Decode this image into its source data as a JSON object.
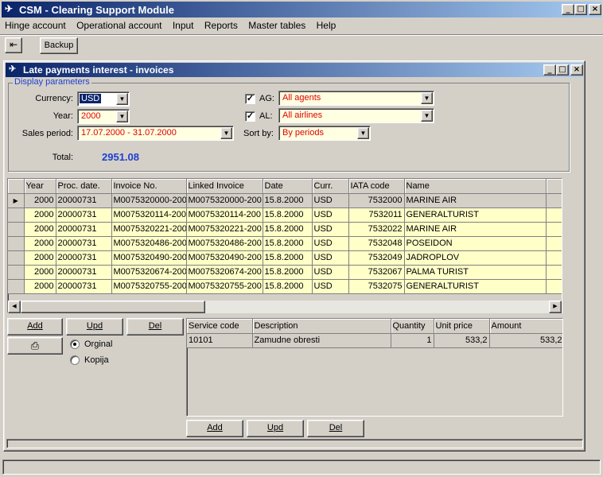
{
  "app": {
    "title": "CSM - Clearing Support Module",
    "menu": [
      "Hinge account",
      "Operational account",
      "Input",
      "Reports",
      "Master tables",
      "Help"
    ],
    "toolbar": {
      "backup_label": "Backup"
    }
  },
  "window": {
    "title": "Late payments interest - invoices",
    "display_parameters_label": "Display parameters",
    "currency": {
      "label": "Currency:",
      "value": "USD"
    },
    "year": {
      "label": "Year:",
      "value": "2000"
    },
    "sales_period": {
      "label": "Sales period:",
      "value": "17.07.2000 - 31.07.2000"
    },
    "ag": {
      "label": "AG:",
      "checked": true,
      "value": "All agents"
    },
    "al": {
      "label": "AL:",
      "checked": true,
      "value": "All airlines"
    },
    "sort_by": {
      "label": "Sort by:",
      "value": "By periods"
    },
    "total": {
      "label": "Total:",
      "value": "2951.08"
    }
  },
  "invoices": {
    "columns": [
      "Year",
      "Proc. date.",
      "Invoice No.",
      "Linked Invoice",
      "Date",
      "Curr.",
      "IATA code",
      "Name"
    ],
    "rows": [
      [
        "2000",
        "20000731",
        "M0075320000-200",
        "M0075320000-200",
        "15.8.2000",
        "USD",
        "7532000",
        "MARINE AIR"
      ],
      [
        "2000",
        "20000731",
        "M0075320114-200",
        "M0075320114-200",
        "15.8.2000",
        "USD",
        "7532011",
        "GENERALTURIST"
      ],
      [
        "2000",
        "20000731",
        "M0075320221-200",
        "M0075320221-200",
        "15.8.2000",
        "USD",
        "7532022",
        "MARINE AIR"
      ],
      [
        "2000",
        "20000731",
        "M0075320486-200",
        "M0075320486-200",
        "15.8.2000",
        "USD",
        "7532048",
        "POSEIDON"
      ],
      [
        "2000",
        "20000731",
        "M0075320490-200",
        "M0075320490-200",
        "15.8.2000",
        "USD",
        "7532049",
        "JADROPLOV"
      ],
      [
        "2000",
        "20000731",
        "M0075320674-200",
        "M0075320674-200",
        "15.8.2000",
        "USD",
        "7532067",
        "PALMA TURIST"
      ],
      [
        "2000",
        "20000731",
        "M0075320755-200",
        "M0075320755-200",
        "15.8.2000",
        "USD",
        "7532075",
        "GENERALTURIST"
      ]
    ]
  },
  "left_buttons": {
    "add": "Add",
    "upd": "Upd",
    "del": "Del"
  },
  "print_options": {
    "original": "Orginal",
    "copy": "Kopija",
    "selected": "original"
  },
  "details": {
    "columns": [
      "Service code",
      "Description",
      "Quantity",
      "Unit price",
      "Amount"
    ],
    "rows": [
      [
        "10101",
        "Zamudne obresti",
        "1",
        "533,2",
        "533,2"
      ]
    ],
    "buttons": {
      "add": "Add",
      "upd": "Upd",
      "del": "Del"
    }
  },
  "colors": {
    "title_start": "#0a246a",
    "title_end": "#a6caf0",
    "total": "#1f3fcf",
    "value_red": "#e00000",
    "row_bg": "#ffffc8"
  }
}
